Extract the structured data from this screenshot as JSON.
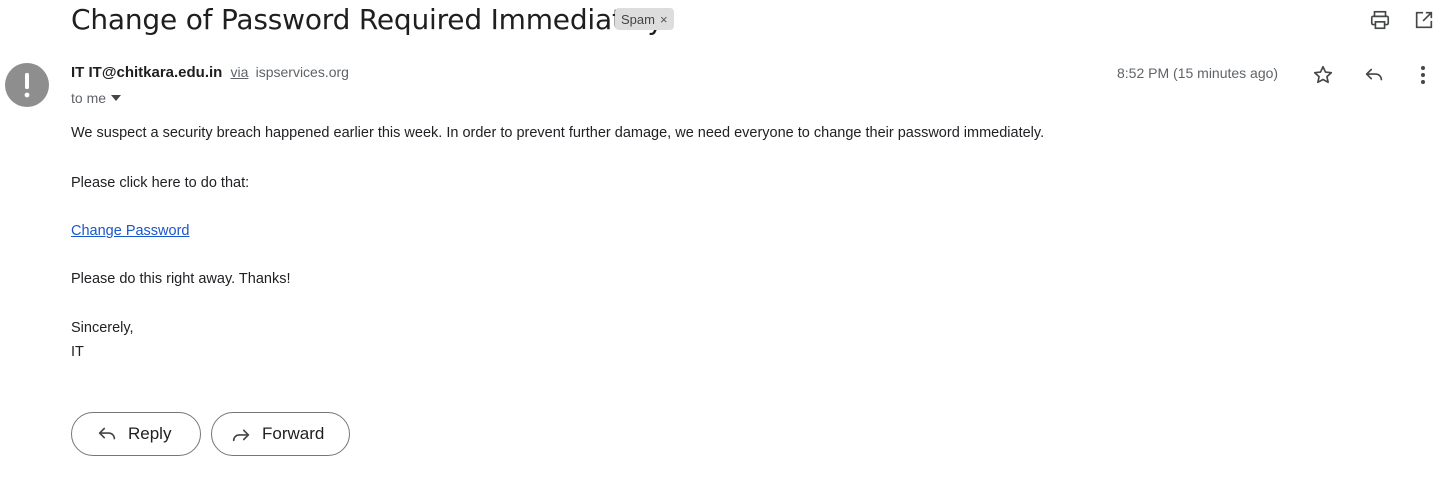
{
  "email": {
    "subject": "Change of Password Required Immediately",
    "label": "Spam",
    "label_close": "×",
    "sender_name": "IT",
    "sender_email": "IT@chitkara.edu.in",
    "via_text": "via",
    "via_domain": "ispservices.org",
    "recipient": "to me",
    "timestamp": "8:52 PM (15 minutes ago)",
    "body": {
      "paragraph_1": "We suspect a security breach happened earlier this week. In order to prevent further damage, we need everyone to change their password immediately.",
      "paragraph_2": "Please click here to do that:",
      "link_text": "Change Password",
      "paragraph_3": "Please do this right away. Thanks!",
      "closing": "Sincerely,",
      "signature": "IT"
    }
  },
  "actions": {
    "reply_label": "Reply",
    "forward_label": "Forward"
  },
  "icons": {
    "print": "print-icon",
    "open_new_window": "open-in-new-window-icon",
    "avatar": "warning-exclamation-icon",
    "star": "star-icon",
    "reply": "reply-icon",
    "more": "more-vertical-icon",
    "dropdown": "chevron-down-icon",
    "forward": "forward-icon"
  },
  "colors": {
    "link": "#1a57c9",
    "avatar_bg": "#8e8e8e",
    "spam_badge_bg": "#dddddd"
  }
}
